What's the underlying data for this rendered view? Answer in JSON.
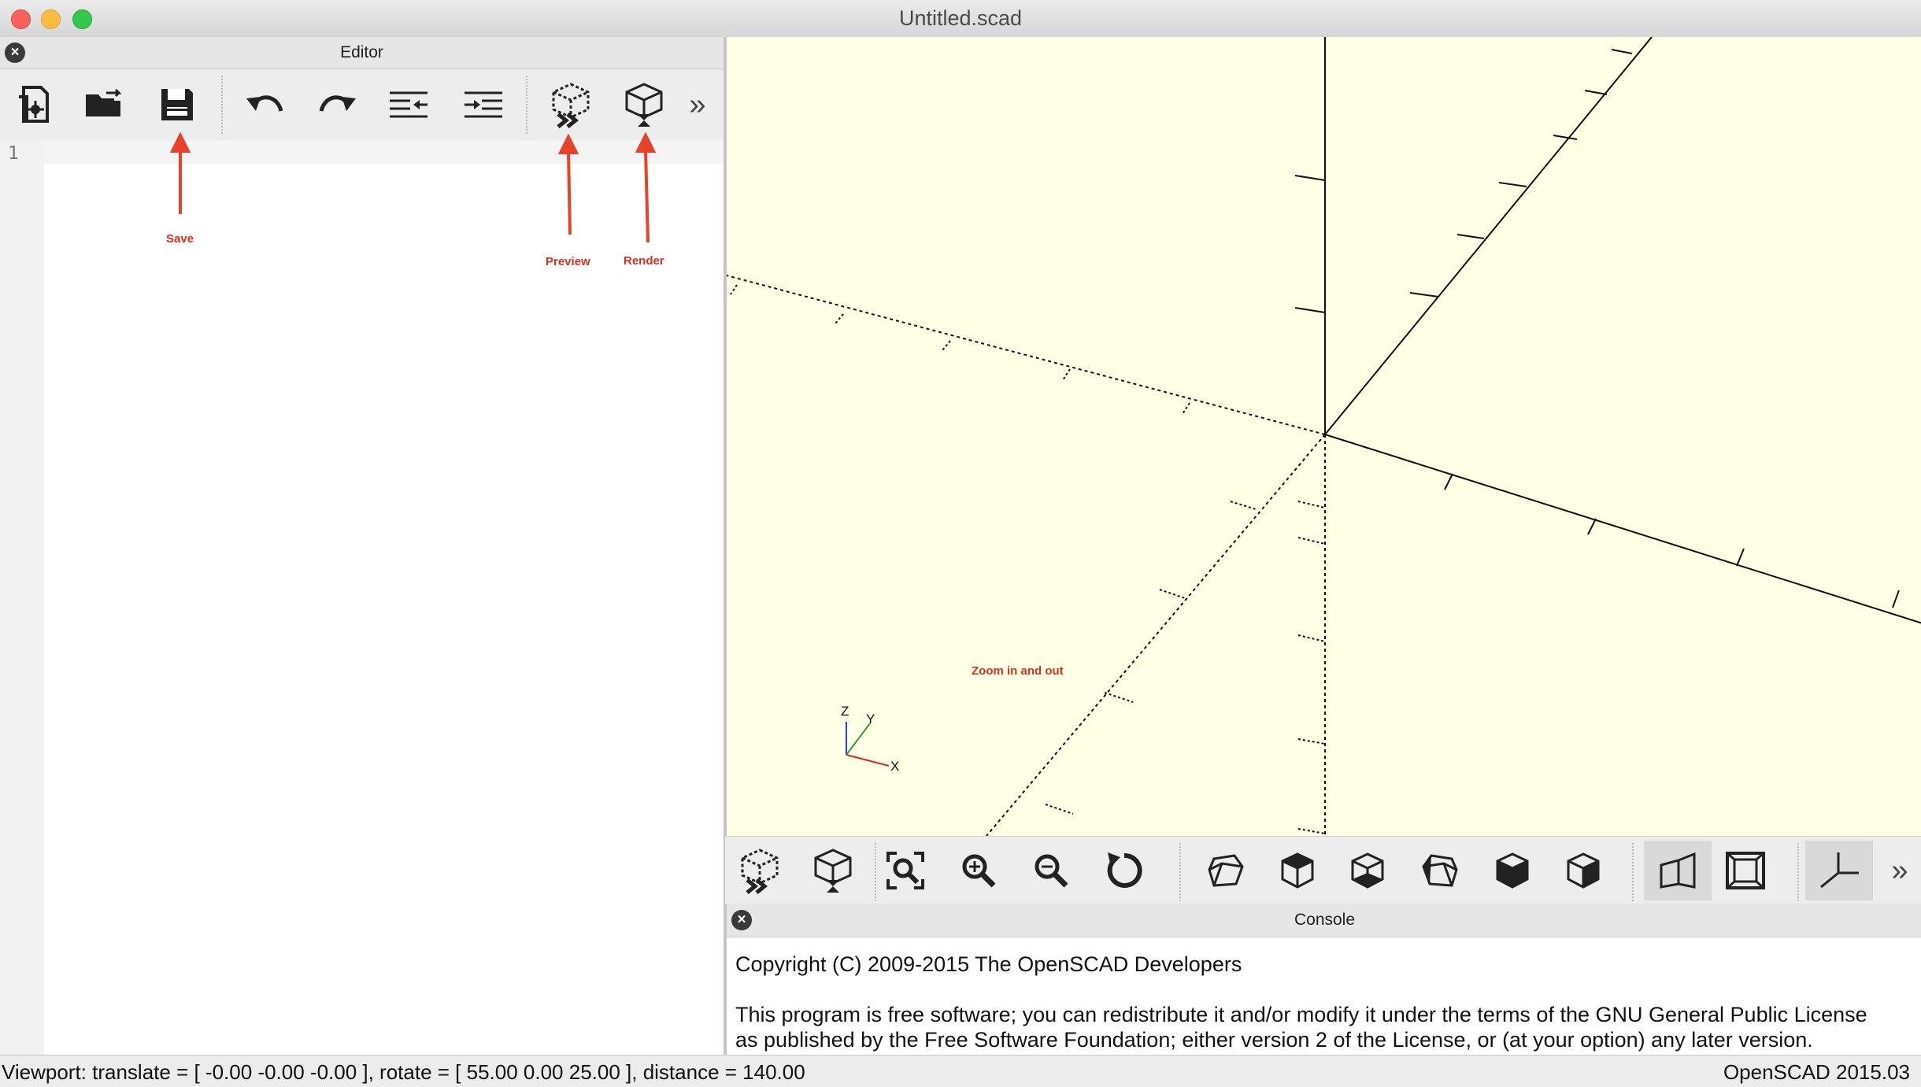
{
  "window": {
    "title": "Untitled.scad"
  },
  "editor": {
    "panel_title": "Editor",
    "line_numbers": [
      "1"
    ],
    "toolbar": [
      "new-file-icon",
      "open-file-icon",
      "save-icon",
      "undo-icon",
      "redo-icon",
      "unindent-icon",
      "indent-icon",
      "preview-icon",
      "render-icon",
      "more-chevron-icon"
    ],
    "overflow_glyph": "»"
  },
  "annotations": {
    "save": "Save",
    "preview": "Preview",
    "render": "Render",
    "zoom": "Zoom in and out",
    "color": "#d7301f"
  },
  "viewport": {
    "background": "#ffffe5",
    "axis_labels": {
      "x": "X",
      "y": "Y",
      "z": "Z"
    },
    "toolbar": [
      "preview-icon",
      "render-icon",
      "view-all-icon",
      "zoom-in-icon",
      "zoom-out-icon",
      "reset-view-icon",
      "view-right-icon",
      "view-top-icon",
      "view-bottom-icon",
      "view-left-icon",
      "view-front-icon",
      "view-back-icon",
      "perspective-icon",
      "orthogonal-icon",
      "show-axes-icon",
      "more-chevron-icon"
    ],
    "overflow_glyph": "»"
  },
  "console": {
    "panel_title": "Console",
    "lines": [
      "Copyright (C) 2009-2015 The OpenSCAD Developers",
      "",
      "This program is free software; you can redistribute it and/or modify it under the terms of the GNU General Public License",
      "as published by the Free Software Foundation; either version 2 of the License, or (at your option) any later version."
    ]
  },
  "status": {
    "viewport": "Viewport: translate = [ -0.00 -0.00 -0.00 ], rotate = [ 55.00 0.00 25.00 ], distance = 140.00",
    "version": "OpenSCAD 2015.03"
  }
}
